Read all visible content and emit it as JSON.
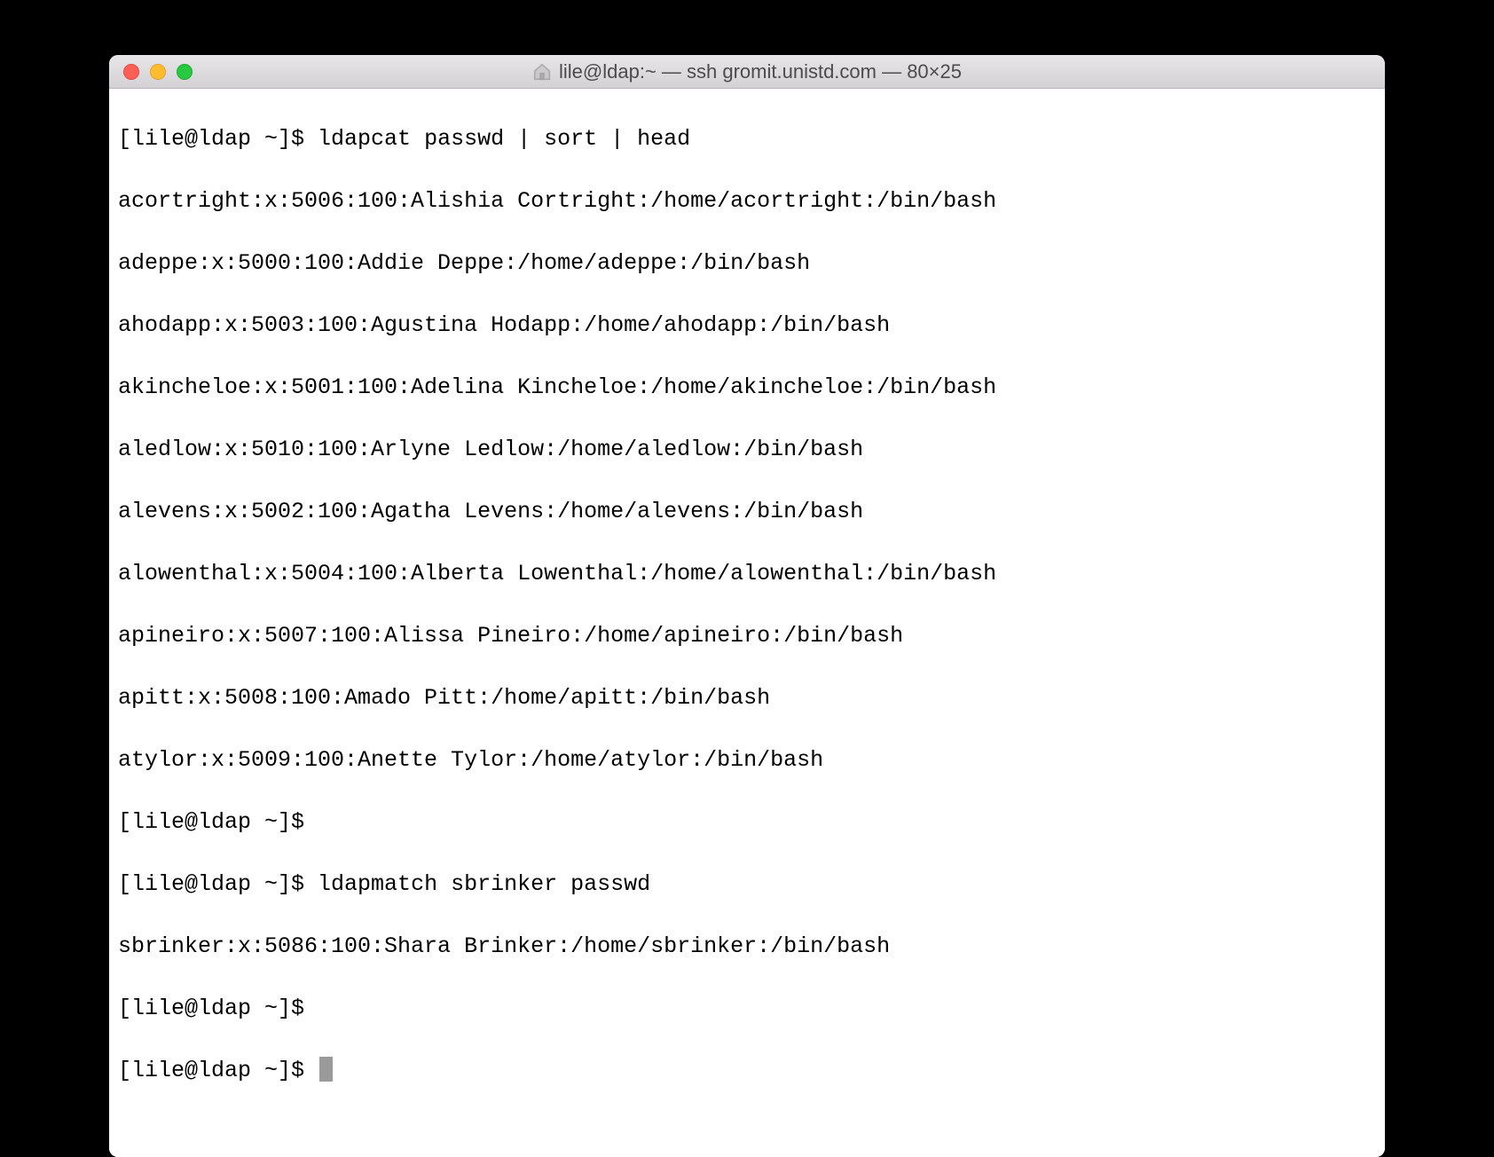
{
  "window": {
    "title": "lile@ldap:~ — ssh gromit.unistd.com — 80×25"
  },
  "terminal": {
    "prompt": "[lile@ldap ~]$ ",
    "commands": {
      "cmd1": "ldapcat passwd | sort | head",
      "cmd2": "ldapmatch sbrinker passwd"
    },
    "cmd1_output": [
      "acortright:x:5006:100:Alishia Cortright:/home/acortright:/bin/bash",
      "adeppe:x:5000:100:Addie Deppe:/home/adeppe:/bin/bash",
      "ahodapp:x:5003:100:Agustina Hodapp:/home/ahodapp:/bin/bash",
      "akincheloe:x:5001:100:Adelina Kincheloe:/home/akincheloe:/bin/bash",
      "aledlow:x:5010:100:Arlyne Ledlow:/home/aledlow:/bin/bash",
      "alevens:x:5002:100:Agatha Levens:/home/alevens:/bin/bash",
      "alowenthal:x:5004:100:Alberta Lowenthal:/home/alowenthal:/bin/bash",
      "apineiro:x:5007:100:Alissa Pineiro:/home/apineiro:/bin/bash",
      "apitt:x:5008:100:Amado Pitt:/home/apitt:/bin/bash",
      "atylor:x:5009:100:Anette Tylor:/home/atylor:/bin/bash"
    ],
    "cmd2_output": [
      "sbrinker:x:5086:100:Shara Brinker:/home/sbrinker:/bin/bash"
    ]
  }
}
